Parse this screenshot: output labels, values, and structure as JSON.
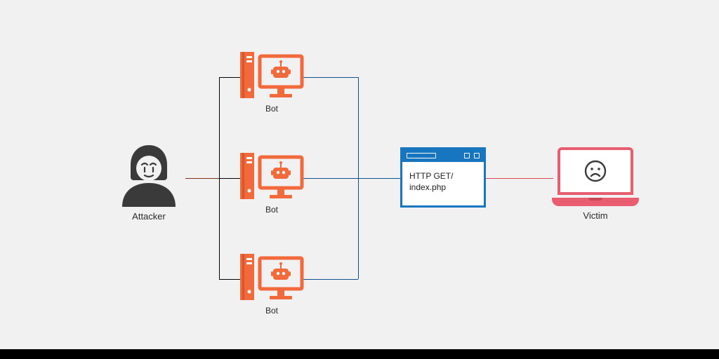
{
  "attacker": {
    "label": "Attacker"
  },
  "bots": [
    {
      "label": "Bot"
    },
    {
      "label": "Bot"
    },
    {
      "label": "Bot"
    }
  ],
  "request": {
    "line1": "HTTP GET/",
    "line2": "index.php"
  },
  "victim": {
    "label": "Victim"
  },
  "colors": {
    "attacker": "#3a3a3a",
    "bot": "#f26a3b",
    "browser": "#1876c0",
    "victim": "#e85d6f",
    "attackerLine": "#7a2e12",
    "botLine": "#0f4f8b",
    "victimLine": "#d64a5c"
  }
}
